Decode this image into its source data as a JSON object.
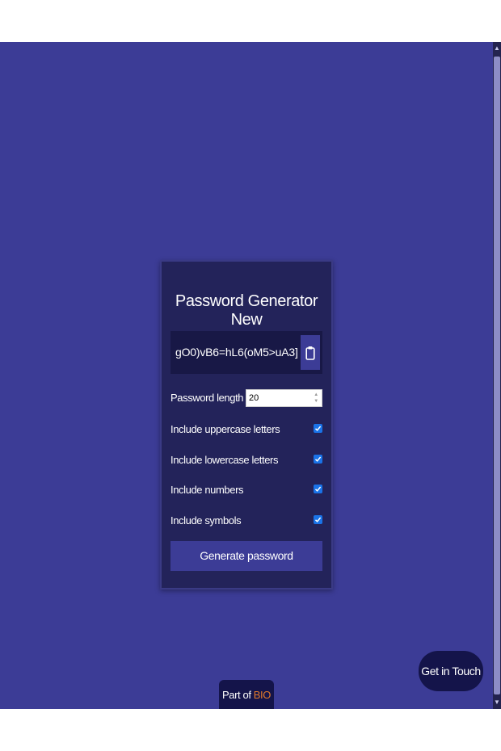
{
  "app": {
    "title": "Password Generator New",
    "password": "gO0)vB6=hL6(oM5>uA3]",
    "length_label": "Password length",
    "length_value": "20",
    "options": [
      {
        "label": "Include uppercase letters",
        "checked": true
      },
      {
        "label": "Include lowercase letters",
        "checked": true
      },
      {
        "label": "Include numbers",
        "checked": true
      },
      {
        "label": "Include symbols",
        "checked": true
      }
    ],
    "generate_label": "Generate password"
  },
  "footer": {
    "get_in_touch": "Get in Touch",
    "part_of": "Part of",
    "brand": "BIO"
  },
  "icons": {
    "clipboard": "clipboard-icon",
    "checkmark": "checkmark-icon"
  },
  "colors": {
    "background": "#3c3c96",
    "card": "#23235a",
    "accent": "#e27a2b",
    "checkbox": "#1a73e8"
  }
}
